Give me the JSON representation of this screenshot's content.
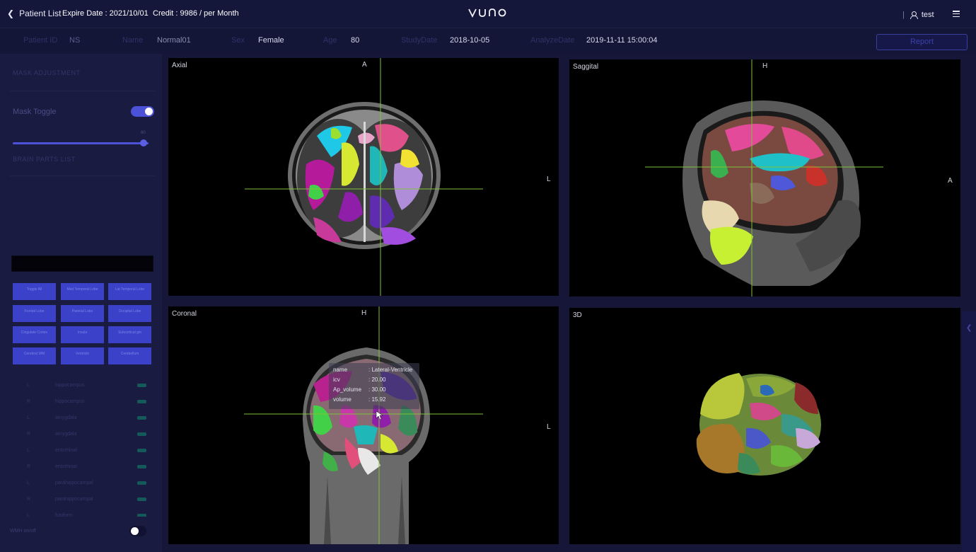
{
  "topbar": {
    "back_label": "Patient List",
    "expire": "Expire Date : 2021/10/01",
    "credit": "Credit : 9986 / per Month",
    "logo": "VUNO",
    "separator": "|",
    "user": "test"
  },
  "patient": {
    "id_label": "Patient ID",
    "id_value": "NS",
    "name_label": "Name",
    "name_value": "Normal01",
    "sex_label": "Sex",
    "sex_value": "Female",
    "age_label": "Age",
    "age_value": "80",
    "study_label": "StudyDate",
    "study_value": "2018-10-05",
    "analyze_label": "AnalyzeDate",
    "analyze_value": "2019-11-11 15:00:04",
    "report_label": "Report"
  },
  "sidebar": {
    "mask_adjustment": "MASK ADJUSTMENT",
    "mask_toggle": "Mask Toggle",
    "mask_toggle_on": true,
    "slider_value": "80",
    "slider_level": 0.95,
    "brain_parts": "BRAIN PARTS LIST",
    "search_value": "",
    "region_buttons": [
      "Toggle All",
      "Med Temporal Lobe",
      "Lat Temporal Lobe",
      "Frontal Lobe",
      "Parietal Lobe",
      "Occipital Lobe",
      "Cingulate Cortex",
      "Insula",
      "Subcortical gm",
      "Cerebral WM",
      "Ventricle",
      "Cerebellum"
    ],
    "regions": [
      {
        "side": "L",
        "name": "hippocampus"
      },
      {
        "side": "R",
        "name": "hippocampus"
      },
      {
        "side": "L",
        "name": "amygdala"
      },
      {
        "side": "R",
        "name": "amygdala"
      },
      {
        "side": "L",
        "name": "entorhinal"
      },
      {
        "side": "R",
        "name": "entorhinal"
      },
      {
        "side": "L",
        "name": "parahippocampal"
      },
      {
        "side": "R",
        "name": "parahippocampal"
      },
      {
        "side": "L",
        "name": "fusiform"
      }
    ],
    "wmh_label": "WMH on/off",
    "wmh_on": false
  },
  "viewer": {
    "axial": {
      "title": "Axial",
      "top": "A",
      "right": "L"
    },
    "sagittal": {
      "title": "Saggital",
      "top": "H",
      "right": "A"
    },
    "coronal": {
      "title": "Coronal",
      "top": "H",
      "right": "L"
    },
    "threed": {
      "title": "3D"
    }
  },
  "tooltip": {
    "name_k": "name",
    "name_v": ": Lateral-Ventricle",
    "icv_k": "icv",
    "icv_v": ": 20.00",
    "ap_k": "Ap_volume",
    "ap_v": ": 30.00",
    "vol_k": "volume",
    "vol_v": ": 15.92"
  },
  "colors": {
    "accent": "#4c52d8",
    "background": "#151638",
    "crosshair": "#7fc23a"
  },
  "icons": {
    "back": "chevron-left-icon",
    "user": "user-icon",
    "menu": "menu-icon",
    "collapse": "chevron-left-icon"
  }
}
